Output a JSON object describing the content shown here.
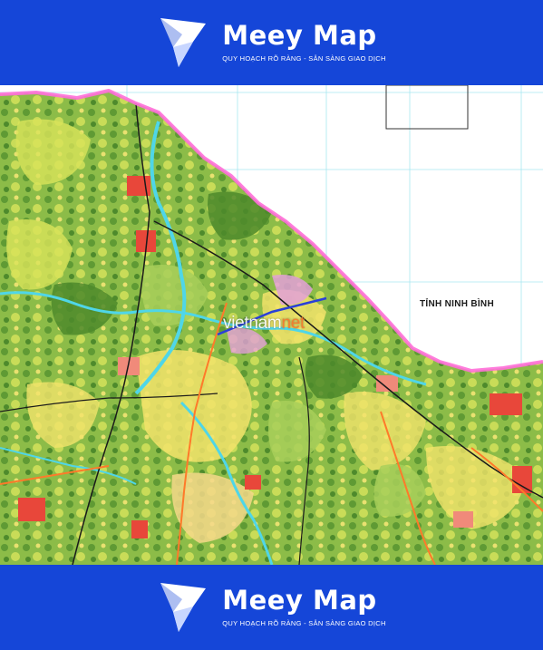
{
  "header_banner": {
    "brand_name": "Meey Map",
    "tagline": "QUY HOẠCH RÕ RÀNG - SẴN SÀNG GIAO DỊCH",
    "background_color": "#1546d8",
    "logo_icon": "meey-map-logo-icon"
  },
  "footer_banner": {
    "brand_name": "Meey Map",
    "tagline": "QUY HOẠCH RÕ RÀNG - SẴN SÀNG GIAO DỊCH",
    "background_color": "#1546d8",
    "logo_icon": "meey-map-logo-icon"
  },
  "map": {
    "province_label": "TỈNH NINH BÌNH",
    "watermark": {
      "text_main": "vietnam",
      "text_accent": "net"
    },
    "colors": {
      "forest_green": "#6fa63c",
      "light_green": "#a8cf5a",
      "yellow_green": "#d9e35a",
      "residential_yellow": "#f2e36b",
      "boundary_magenta": "#ff6ed8",
      "river_cyan": "#4fd6e8",
      "urban_red": "#e8473a",
      "road_black": "#1a1a1a",
      "grid_cyan": "#a8e8f0"
    }
  }
}
